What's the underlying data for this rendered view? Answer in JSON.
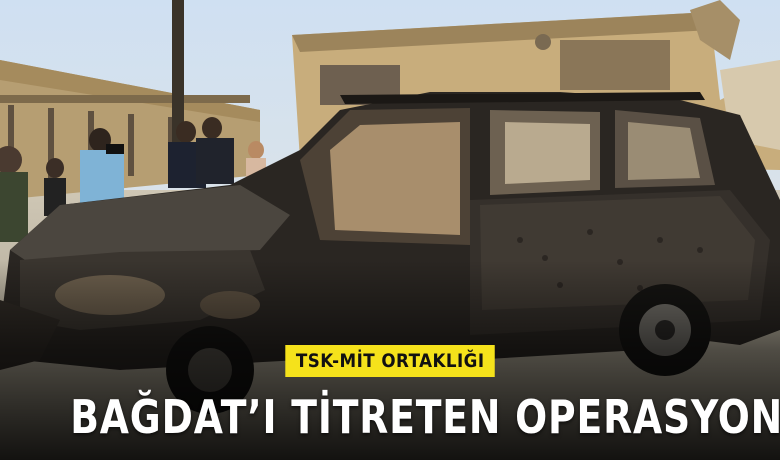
{
  "kicker": "TSK-MİT ORTAKLIĞI",
  "headline": "BAĞDAT’I TİTRETEN OPERASYON",
  "colors": {
    "kicker_bg": "#f5e21b",
    "headline_text": "#ffffff"
  }
}
